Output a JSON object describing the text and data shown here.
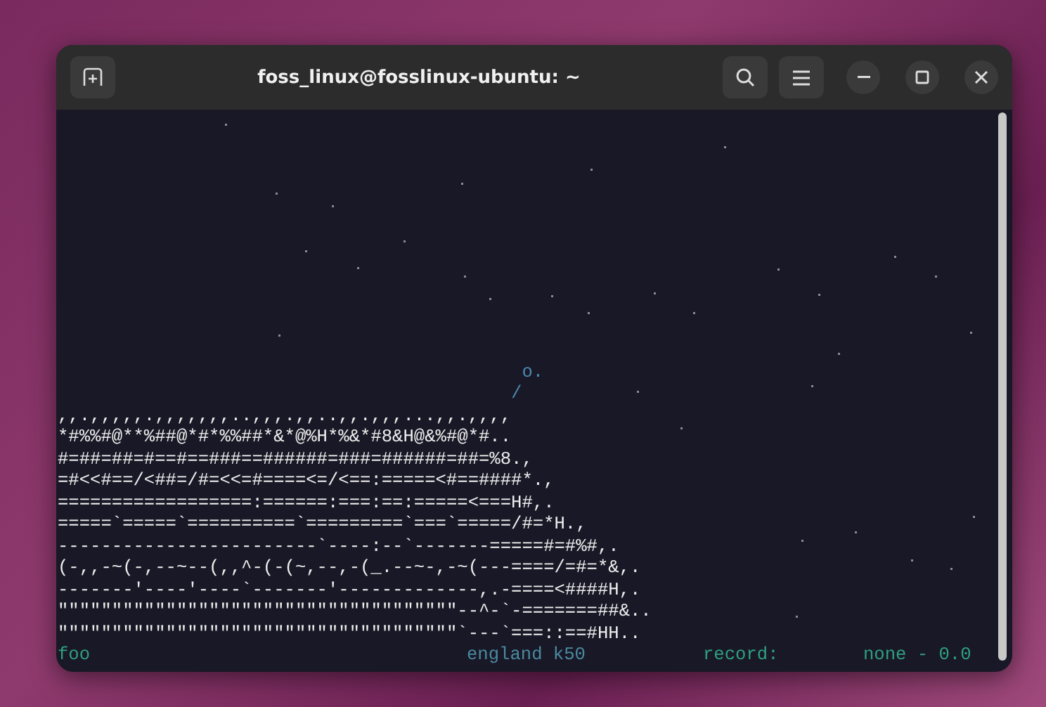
{
  "window": {
    "title": "foss_linux@fosslinux-ubuntu: ~"
  },
  "terminal": {
    "lines": [
      "                                           o.",
      "                                          /",
      ",,.,,,,,.,,,,,,,..,,,.,,..,,.,,,...,,.,,,,",
      "*#%%#@**%##@*#*%%##*&*@%H*%&*#8&H@&%#@*#..",
      "#=##=##=#==#==###==######=###=######=##=%8.,",
      "=#<<#==/<##=/#=<<=#====<=/<==:=====<#==####*.,",
      "==================:======:===:==:=====<===H#,.",
      "=====`=====`==========`=========`===`=====/#=*H.,",
      "------------------------`----:--`-------=====#=#%#,.",
      "(-,,-~(-,--~--(,,^-(-(~,--,-(_.--~-,-~(---====/=#=*&,.",
      "-------'----'----`-------'-------------,.-====<####H,.",
      "\"\"\"\"\"\"\"\"\"\"\"\"\"\"\"\"\"\"\"\"\"\"\"\"\"\"\"\"\"\"\"\"\"\"\"\"\"--^-`-=======##&..",
      "\"\"\"\"\"\"\"\"\"\"\"\"\"\"\"\"\"\"\"\"\"\"\"\"\"\"\"\"\"\"\"\"\"\"\"\"\"`---`===::==#HH.."
    ],
    "status": {
      "left": "foo",
      "center": "england k50",
      "label": "record:",
      "value": "none - 0.0"
    }
  }
}
